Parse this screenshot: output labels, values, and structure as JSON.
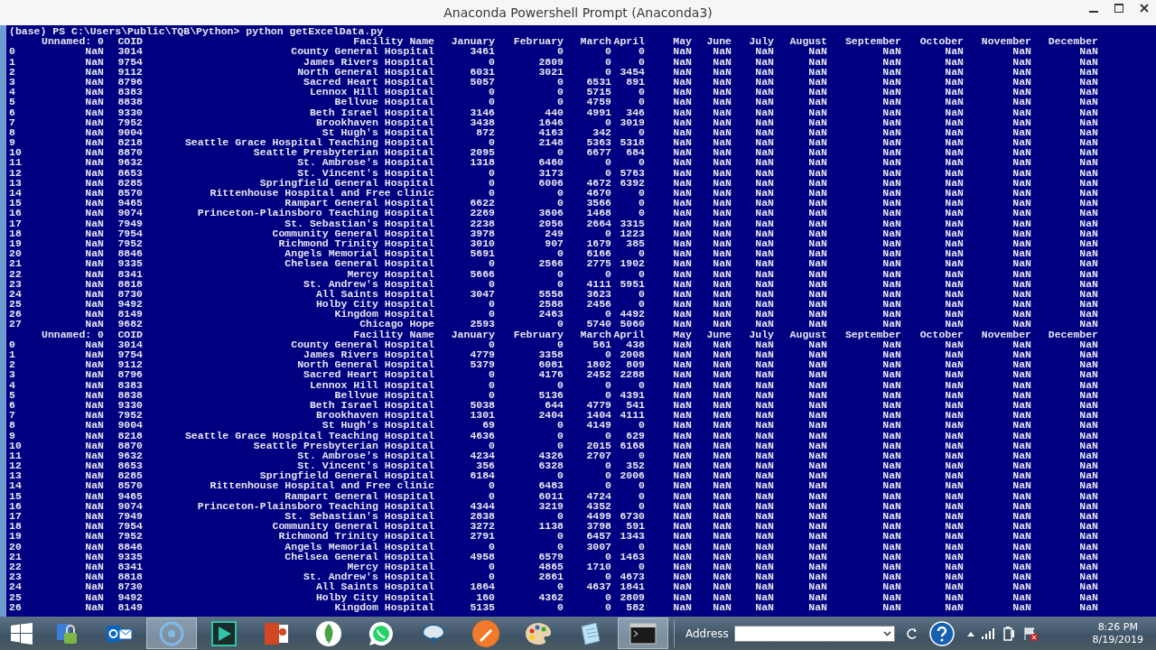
{
  "window": {
    "title": "Anaconda Powershell Prompt (Anaconda3)"
  },
  "console": {
    "command_line": "(base) PS C:\\Users\\Public\\TQB\\Python> python getExcelData.py",
    "blocks": [
      {
        "columns": [
          "Unnamed: 0",
          "COID",
          "Facility Name",
          "January",
          "February",
          "March",
          "April",
          "May",
          "June",
          "July",
          "August",
          "September",
          "October",
          "November",
          "December"
        ],
        "rows": [
          {
            "index": "0",
            "cells": [
              "NaN",
              "3014",
              "County General Hospital",
              "3461",
              "0",
              "0",
              "0",
              "NaN",
              "NaN",
              "NaN",
              "NaN",
              "NaN",
              "NaN",
              "NaN",
              "NaN"
            ]
          },
          {
            "index": "1",
            "cells": [
              "NaN",
              "9754",
              "James Rivers Hospital",
              "0",
              "2809",
              "0",
              "0",
              "NaN",
              "NaN",
              "NaN",
              "NaN",
              "NaN",
              "NaN",
              "NaN",
              "NaN"
            ]
          },
          {
            "index": "2",
            "cells": [
              "NaN",
              "9112",
              "North General Hospital",
              "6031",
              "3021",
              "0",
              "3454",
              "NaN",
              "NaN",
              "NaN",
              "NaN",
              "NaN",
              "NaN",
              "NaN",
              "NaN"
            ]
          },
          {
            "index": "3",
            "cells": [
              "NaN",
              "8796",
              "Sacred Heart Hospital",
              "5057",
              "0",
              "6531",
              "891",
              "NaN",
              "NaN",
              "NaN",
              "NaN",
              "NaN",
              "NaN",
              "NaN",
              "NaN"
            ]
          },
          {
            "index": "4",
            "cells": [
              "NaN",
              "8383",
              "Lennox Hill Hospital",
              "0",
              "0",
              "5715",
              "0",
              "NaN",
              "NaN",
              "NaN",
              "NaN",
              "NaN",
              "NaN",
              "NaN",
              "NaN"
            ]
          },
          {
            "index": "5",
            "cells": [
              "NaN",
              "8838",
              "Bellvue Hospital",
              "0",
              "0",
              "4759",
              "0",
              "NaN",
              "NaN",
              "NaN",
              "NaN",
              "NaN",
              "NaN",
              "NaN",
              "NaN"
            ]
          },
          {
            "index": "6",
            "cells": [
              "NaN",
              "9330",
              "Beth Israel Hospital",
              "3146",
              "440",
              "4991",
              "346",
              "NaN",
              "NaN",
              "NaN",
              "NaN",
              "NaN",
              "NaN",
              "NaN",
              "NaN"
            ]
          },
          {
            "index": "7",
            "cells": [
              "NaN",
              "7952",
              "Brookhaven Hospital",
              "3438",
              "1646",
              "0",
              "3019",
              "NaN",
              "NaN",
              "NaN",
              "NaN",
              "NaN",
              "NaN",
              "NaN",
              "NaN"
            ]
          },
          {
            "index": "8",
            "cells": [
              "NaN",
              "9004",
              "St Hugh's Hospital",
              "872",
              "4163",
              "342",
              "0",
              "NaN",
              "NaN",
              "NaN",
              "NaN",
              "NaN",
              "NaN",
              "NaN",
              "NaN"
            ]
          },
          {
            "index": "9",
            "cells": [
              "NaN",
              "8218",
              "Seattle Grace Hospital Teaching Hospital",
              "0",
              "2148",
              "5363",
              "5318",
              "NaN",
              "NaN",
              "NaN",
              "NaN",
              "NaN",
              "NaN",
              "NaN",
              "NaN"
            ]
          },
          {
            "index": "10",
            "cells": [
              "NaN",
              "8870",
              "Seattle Presbyterian Hospital",
              "2095",
              "0",
              "6677",
              "684",
              "NaN",
              "NaN",
              "NaN",
              "NaN",
              "NaN",
              "NaN",
              "NaN",
              "NaN"
            ]
          },
          {
            "index": "11",
            "cells": [
              "NaN",
              "9632",
              "St. Ambrose's Hospital",
              "1318",
              "6460",
              "0",
              "0",
              "NaN",
              "NaN",
              "NaN",
              "NaN",
              "NaN",
              "NaN",
              "NaN",
              "NaN"
            ]
          },
          {
            "index": "12",
            "cells": [
              "NaN",
              "8653",
              "St. Vincent's Hospital",
              "0",
              "3173",
              "0",
              "5763",
              "NaN",
              "NaN",
              "NaN",
              "NaN",
              "NaN",
              "NaN",
              "NaN",
              "NaN"
            ]
          },
          {
            "index": "13",
            "cells": [
              "NaN",
              "8285",
              "Springfield General Hospital",
              "0",
              "6006",
              "4672",
              "6392",
              "NaN",
              "NaN",
              "NaN",
              "NaN",
              "NaN",
              "NaN",
              "NaN",
              "NaN"
            ]
          },
          {
            "index": "14",
            "cells": [
              "NaN",
              "8570",
              "Rittenhouse Hospital and Free clinic",
              "0",
              "0",
              "4670",
              "0",
              "NaN",
              "NaN",
              "NaN",
              "NaN",
              "NaN",
              "NaN",
              "NaN",
              "NaN"
            ]
          },
          {
            "index": "15",
            "cells": [
              "NaN",
              "9465",
              "Rampart General Hospital",
              "6622",
              "0",
              "3566",
              "0",
              "NaN",
              "NaN",
              "NaN",
              "NaN",
              "NaN",
              "NaN",
              "NaN",
              "NaN"
            ]
          },
          {
            "index": "16",
            "cells": [
              "NaN",
              "9074",
              "Princeton-Plainsboro Teaching Hospital",
              "2269",
              "3606",
              "1468",
              "0",
              "NaN",
              "NaN",
              "NaN",
              "NaN",
              "NaN",
              "NaN",
              "NaN",
              "NaN"
            ]
          },
          {
            "index": "17",
            "cells": [
              "NaN",
              "7949",
              "St. Sebastian's Hospital",
              "2238",
              "2056",
              "2664",
              "3315",
              "NaN",
              "NaN",
              "NaN",
              "NaN",
              "NaN",
              "NaN",
              "NaN",
              "NaN"
            ]
          },
          {
            "index": "18",
            "cells": [
              "NaN",
              "7954",
              "Community General Hospital",
              "3978",
              "249",
              "0",
              "1223",
              "NaN",
              "NaN",
              "NaN",
              "NaN",
              "NaN",
              "NaN",
              "NaN",
              "NaN"
            ]
          },
          {
            "index": "19",
            "cells": [
              "NaN",
              "7952",
              "Richmond Trinity Hospital",
              "3010",
              "907",
              "1679",
              "385",
              "NaN",
              "NaN",
              "NaN",
              "NaN",
              "NaN",
              "NaN",
              "NaN",
              "NaN"
            ]
          },
          {
            "index": "20",
            "cells": [
              "NaN",
              "8846",
              "Angels Memorial Hospital",
              "5691",
              "0",
              "6166",
              "0",
              "NaN",
              "NaN",
              "NaN",
              "NaN",
              "NaN",
              "NaN",
              "NaN",
              "NaN"
            ]
          },
          {
            "index": "21",
            "cells": [
              "NaN",
              "9335",
              "Chelsea General Hospital",
              "0",
              "2566",
              "2775",
              "1902",
              "NaN",
              "NaN",
              "NaN",
              "NaN",
              "NaN",
              "NaN",
              "NaN",
              "NaN"
            ]
          },
          {
            "index": "22",
            "cells": [
              "NaN",
              "8341",
              "Mercy Hospital",
              "5666",
              "0",
              "0",
              "0",
              "NaN",
              "NaN",
              "NaN",
              "NaN",
              "NaN",
              "NaN",
              "NaN",
              "NaN"
            ]
          },
          {
            "index": "23",
            "cells": [
              "NaN",
              "8818",
              "St. Andrew's Hospital",
              "0",
              "0",
              "4111",
              "5951",
              "NaN",
              "NaN",
              "NaN",
              "NaN",
              "NaN",
              "NaN",
              "NaN",
              "NaN"
            ]
          },
          {
            "index": "24",
            "cells": [
              "NaN",
              "8730",
              "All Saints Hospital",
              "3047",
              "5558",
              "3623",
              "0",
              "NaN",
              "NaN",
              "NaN",
              "NaN",
              "NaN",
              "NaN",
              "NaN",
              "NaN"
            ]
          },
          {
            "index": "25",
            "cells": [
              "NaN",
              "9492",
              "Holby City Hospital",
              "0",
              "2588",
              "2456",
              "0",
              "NaN",
              "NaN",
              "NaN",
              "NaN",
              "NaN",
              "NaN",
              "NaN",
              "NaN"
            ]
          },
          {
            "index": "26",
            "cells": [
              "NaN",
              "8149",
              "Kingdom Hospital",
              "0",
              "2463",
              "0",
              "4492",
              "NaN",
              "NaN",
              "NaN",
              "NaN",
              "NaN",
              "NaN",
              "NaN",
              "NaN"
            ]
          },
          {
            "index": "27",
            "cells": [
              "NaN",
              "9682",
              "Chicago Hope",
              "2593",
              "0",
              "5740",
              "5060",
              "NaN",
              "NaN",
              "NaN",
              "NaN",
              "NaN",
              "NaN",
              "NaN",
              "NaN"
            ]
          }
        ]
      },
      {
        "columns": [
          "Unnamed: 0",
          "COID",
          "Facility Name",
          "January",
          "February",
          "March",
          "April",
          "May",
          "June",
          "July",
          "August",
          "September",
          "October",
          "November",
          "December"
        ],
        "rows": [
          {
            "index": "0",
            "cells": [
              "NaN",
              "3014",
              "County General Hospital",
              "0",
              "0",
              "561",
              "438",
              "NaN",
              "NaN",
              "NaN",
              "NaN",
              "NaN",
              "NaN",
              "NaN",
              "NaN"
            ]
          },
          {
            "index": "1",
            "cells": [
              "NaN",
              "9754",
              "James Rivers Hospital",
              "4779",
              "3358",
              "0",
              "2008",
              "NaN",
              "NaN",
              "NaN",
              "NaN",
              "NaN",
              "NaN",
              "NaN",
              "NaN"
            ]
          },
          {
            "index": "2",
            "cells": [
              "NaN",
              "9112",
              "North General Hospital",
              "5379",
              "6081",
              "1802",
              "809",
              "NaN",
              "NaN",
              "NaN",
              "NaN",
              "NaN",
              "NaN",
              "NaN",
              "NaN"
            ]
          },
          {
            "index": "3",
            "cells": [
              "NaN",
              "8796",
              "Sacred Heart Hospital",
              "0",
              "4176",
              "2452",
              "2288",
              "NaN",
              "NaN",
              "NaN",
              "NaN",
              "NaN",
              "NaN",
              "NaN",
              "NaN"
            ]
          },
          {
            "index": "4",
            "cells": [
              "NaN",
              "8383",
              "Lennox Hill Hospital",
              "0",
              "0",
              "0",
              "0",
              "NaN",
              "NaN",
              "NaN",
              "NaN",
              "NaN",
              "NaN",
              "NaN",
              "NaN"
            ]
          },
          {
            "index": "5",
            "cells": [
              "NaN",
              "8838",
              "Bellvue Hospital",
              "0",
              "5136",
              "0",
              "4391",
              "NaN",
              "NaN",
              "NaN",
              "NaN",
              "NaN",
              "NaN",
              "NaN",
              "NaN"
            ]
          },
          {
            "index": "6",
            "cells": [
              "NaN",
              "9330",
              "Beth Israel Hospital",
              "5038",
              "644",
              "4779",
              "541",
              "NaN",
              "NaN",
              "NaN",
              "NaN",
              "NaN",
              "NaN",
              "NaN",
              "NaN"
            ]
          },
          {
            "index": "7",
            "cells": [
              "NaN",
              "7952",
              "Brookhaven Hospital",
              "1301",
              "2404",
              "1404",
              "4111",
              "NaN",
              "NaN",
              "NaN",
              "NaN",
              "NaN",
              "NaN",
              "NaN",
              "NaN"
            ]
          },
          {
            "index": "8",
            "cells": [
              "NaN",
              "9004",
              "St Hugh's Hospital",
              "69",
              "0",
              "4149",
              "0",
              "NaN",
              "NaN",
              "NaN",
              "NaN",
              "NaN",
              "NaN",
              "NaN",
              "NaN"
            ]
          },
          {
            "index": "9",
            "cells": [
              "NaN",
              "8218",
              "Seattle Grace Hospital Teaching Hospital",
              "4636",
              "0",
              "0",
              "629",
              "NaN",
              "NaN",
              "NaN",
              "NaN",
              "NaN",
              "NaN",
              "NaN",
              "NaN"
            ]
          },
          {
            "index": "10",
            "cells": [
              "NaN",
              "8870",
              "Seattle Presbyterian Hospital",
              "0",
              "0",
              "2015",
              "6168",
              "NaN",
              "NaN",
              "NaN",
              "NaN",
              "NaN",
              "NaN",
              "NaN",
              "NaN"
            ]
          },
          {
            "index": "11",
            "cells": [
              "NaN",
              "9632",
              "St. Ambrose's Hospital",
              "4234",
              "4326",
              "2707",
              "0",
              "NaN",
              "NaN",
              "NaN",
              "NaN",
              "NaN",
              "NaN",
              "NaN",
              "NaN"
            ]
          },
          {
            "index": "12",
            "cells": [
              "NaN",
              "8653",
              "St. Vincent's Hospital",
              "356",
              "6328",
              "0",
              "352",
              "NaN",
              "NaN",
              "NaN",
              "NaN",
              "NaN",
              "NaN",
              "NaN",
              "NaN"
            ]
          },
          {
            "index": "13",
            "cells": [
              "NaN",
              "8285",
              "Springfield General Hospital",
              "6184",
              "0",
              "0",
              "2006",
              "NaN",
              "NaN",
              "NaN",
              "NaN",
              "NaN",
              "NaN",
              "NaN",
              "NaN"
            ]
          },
          {
            "index": "14",
            "cells": [
              "NaN",
              "8570",
              "Rittenhouse Hospital and Free clinic",
              "0",
              "6483",
              "0",
              "0",
              "NaN",
              "NaN",
              "NaN",
              "NaN",
              "NaN",
              "NaN",
              "NaN",
              "NaN"
            ]
          },
          {
            "index": "15",
            "cells": [
              "NaN",
              "9465",
              "Rampart General Hospital",
              "0",
              "6011",
              "4724",
              "0",
              "NaN",
              "NaN",
              "NaN",
              "NaN",
              "NaN",
              "NaN",
              "NaN",
              "NaN"
            ]
          },
          {
            "index": "16",
            "cells": [
              "NaN",
              "9074",
              "Princeton-Plainsboro Teaching Hospital",
              "4344",
              "3219",
              "4352",
              "0",
              "NaN",
              "NaN",
              "NaN",
              "NaN",
              "NaN",
              "NaN",
              "NaN",
              "NaN"
            ]
          },
          {
            "index": "17",
            "cells": [
              "NaN",
              "7949",
              "St. Sebastian's Hospital",
              "2838",
              "0",
              "4499",
              "6730",
              "NaN",
              "NaN",
              "NaN",
              "NaN",
              "NaN",
              "NaN",
              "NaN",
              "NaN"
            ]
          },
          {
            "index": "18",
            "cells": [
              "NaN",
              "7954",
              "Community General Hospital",
              "3272",
              "1138",
              "3798",
              "591",
              "NaN",
              "NaN",
              "NaN",
              "NaN",
              "NaN",
              "NaN",
              "NaN",
              "NaN"
            ]
          },
          {
            "index": "19",
            "cells": [
              "NaN",
              "7952",
              "Richmond Trinity Hospital",
              "2791",
              "0",
              "6457",
              "1343",
              "NaN",
              "NaN",
              "NaN",
              "NaN",
              "NaN",
              "NaN",
              "NaN",
              "NaN"
            ]
          },
          {
            "index": "20",
            "cells": [
              "NaN",
              "8846",
              "Angels Memorial Hospital",
              "0",
              "0",
              "3007",
              "0",
              "NaN",
              "NaN",
              "NaN",
              "NaN",
              "NaN",
              "NaN",
              "NaN",
              "NaN"
            ]
          },
          {
            "index": "21",
            "cells": [
              "NaN",
              "9335",
              "Chelsea General Hospital",
              "4958",
              "6579",
              "0",
              "1463",
              "NaN",
              "NaN",
              "NaN",
              "NaN",
              "NaN",
              "NaN",
              "NaN",
              "NaN"
            ]
          },
          {
            "index": "22",
            "cells": [
              "NaN",
              "8341",
              "Mercy Hospital",
              "0",
              "4865",
              "1710",
              "0",
              "NaN",
              "NaN",
              "NaN",
              "NaN",
              "NaN",
              "NaN",
              "NaN",
              "NaN"
            ]
          },
          {
            "index": "23",
            "cells": [
              "NaN",
              "8818",
              "St. Andrew's Hospital",
              "0",
              "2861",
              "0",
              "4673",
              "NaN",
              "NaN",
              "NaN",
              "NaN",
              "NaN",
              "NaN",
              "NaN",
              "NaN"
            ]
          },
          {
            "index": "24",
            "cells": [
              "NaN",
              "8730",
              "All Saints Hospital",
              "1864",
              "0",
              "4637",
              "1841",
              "NaN",
              "NaN",
              "NaN",
              "NaN",
              "NaN",
              "NaN",
              "NaN",
              "NaN"
            ]
          },
          {
            "index": "25",
            "cells": [
              "NaN",
              "9492",
              "Holby City Hospital",
              "160",
              "4362",
              "0",
              "2809",
              "NaN",
              "NaN",
              "NaN",
              "NaN",
              "NaN",
              "NaN",
              "NaN",
              "NaN"
            ]
          },
          {
            "index": "26",
            "cells": [
              "NaN",
              "8149",
              "Kingdom Hospital",
              "5135",
              "0",
              "0",
              "582",
              "NaN",
              "NaN",
              "NaN",
              "NaN",
              "NaN",
              "NaN",
              "NaN",
              "NaN"
            ]
          }
        ]
      }
    ]
  },
  "taskbar": {
    "apps": [
      {
        "kind": "network",
        "selected": false
      },
      {
        "kind": "mail",
        "selected": false
      },
      {
        "kind": "disc",
        "selected": true
      },
      {
        "kind": "film",
        "selected": false
      },
      {
        "kind": "slides",
        "selected": false
      },
      {
        "kind": "leaf",
        "selected": false
      },
      {
        "kind": "chat",
        "selected": false
      },
      {
        "kind": "satellite",
        "selected": false
      },
      {
        "kind": "pen",
        "selected": false
      },
      {
        "kind": "palette",
        "selected": false
      },
      {
        "kind": "notepad",
        "selected": false
      },
      {
        "kind": "console",
        "selected": true
      }
    ],
    "address_label": "Address",
    "time": "8:26 PM",
    "date": "8/19/2019"
  }
}
